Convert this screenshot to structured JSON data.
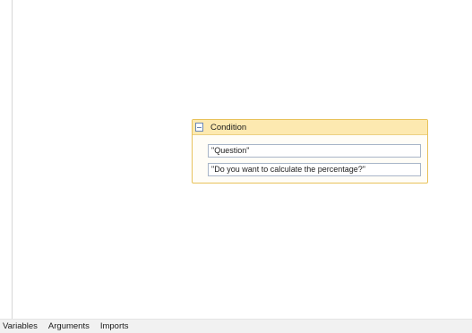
{
  "activity": {
    "title": "Condition",
    "icon": "document-icon",
    "fields": [
      {
        "value": "\"Question\""
      },
      {
        "value": "\"Do you want to calculate the percentage?\""
      }
    ]
  },
  "bottom_tabs": [
    {
      "label": "Variables"
    },
    {
      "label": "Arguments"
    },
    {
      "label": "Imports"
    }
  ],
  "colors": {
    "activity_border": "#e8c25a",
    "activity_header": "#fde9b0",
    "field_border": "#a8b5c8"
  }
}
